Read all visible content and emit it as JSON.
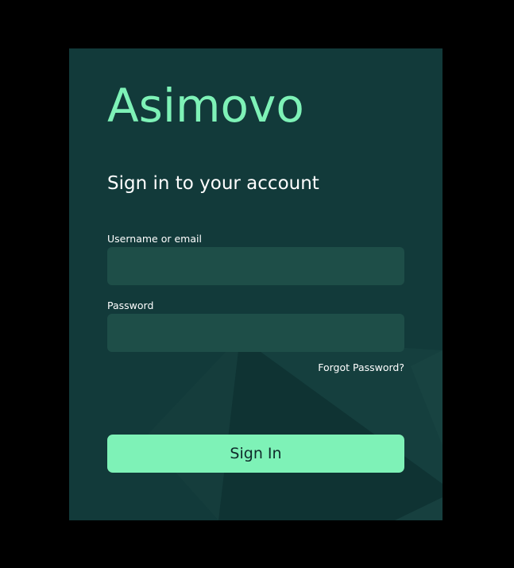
{
  "brand": {
    "name": "Asimovo",
    "accent_color": "#7ef2b7",
    "background_color": "#123a3a"
  },
  "form": {
    "heading": "Sign in to your account",
    "username_label": "Username or email",
    "username_value": "",
    "password_label": "Password",
    "password_value": "",
    "forgot_link": "Forgot Password?",
    "submit_label": "Sign In"
  }
}
